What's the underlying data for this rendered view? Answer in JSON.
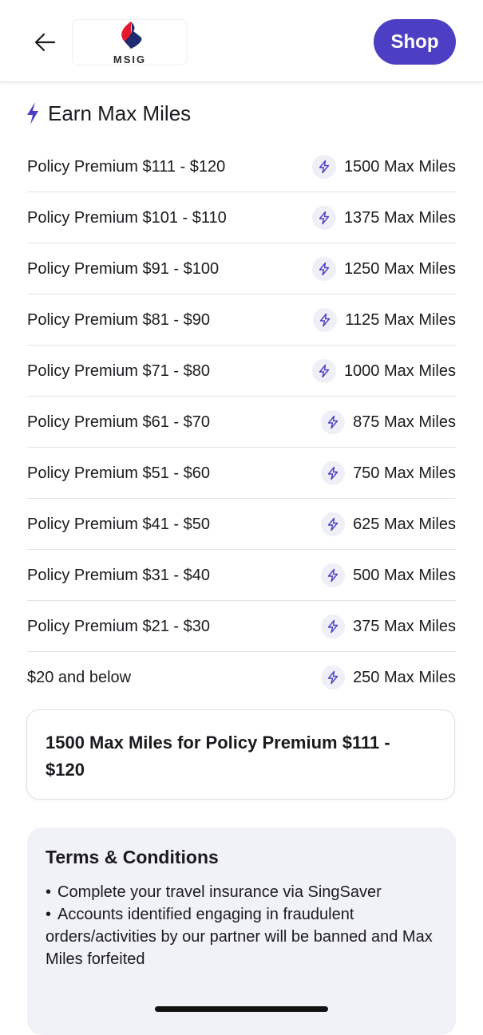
{
  "header": {
    "logo_text": "MSIG",
    "shop_label": "Shop"
  },
  "section": {
    "title": "Earn Max Miles"
  },
  "tiers": [
    {
      "label": "Policy Premium $111 - $120",
      "miles": "1500 Max Miles"
    },
    {
      "label": "Policy Premium $101 - $110",
      "miles": "1375 Max Miles"
    },
    {
      "label": "Policy Premium $91 - $100",
      "miles": "1250 Max Miles"
    },
    {
      "label": "Policy Premium $81 - $90",
      "miles": "1125 Max Miles"
    },
    {
      "label": "Policy Premium $71 - $80",
      "miles": "1000 Max Miles"
    },
    {
      "label": "Policy Premium $61 - $70",
      "miles": "875 Max Miles"
    },
    {
      "label": "Policy Premium $51 - $60",
      "miles": "750 Max Miles"
    },
    {
      "label": "Policy Premium $41 - $50",
      "miles": "625 Max Miles"
    },
    {
      "label": "Policy Premium $31 - $40",
      "miles": "500 Max Miles"
    },
    {
      "label": "Policy Premium $21 - $30",
      "miles": "375 Max Miles"
    },
    {
      "label": "$20 and below",
      "miles": "250 Max Miles"
    }
  ],
  "summary": {
    "text": "1500 Max Miles for Policy Premium $111 - $120"
  },
  "terms": {
    "title": "Terms & Conditions",
    "items": [
      "Complete your travel insurance via SingSaver",
      "Accounts identified engaging in fraudulent orders/activities by our partner will be banned and Max Miles forfeited"
    ]
  },
  "icons": {
    "back": "arrow-left-icon",
    "bolt": "lightning-bolt-icon",
    "logo": "msig-logo-icon"
  },
  "colors": {
    "accent": "#4c3fc4",
    "bolt_badge_bg": "#eff0f7",
    "terms_bg": "#f1f2f8",
    "logo_red": "#e5192d",
    "logo_navy": "#1d2b6f"
  }
}
